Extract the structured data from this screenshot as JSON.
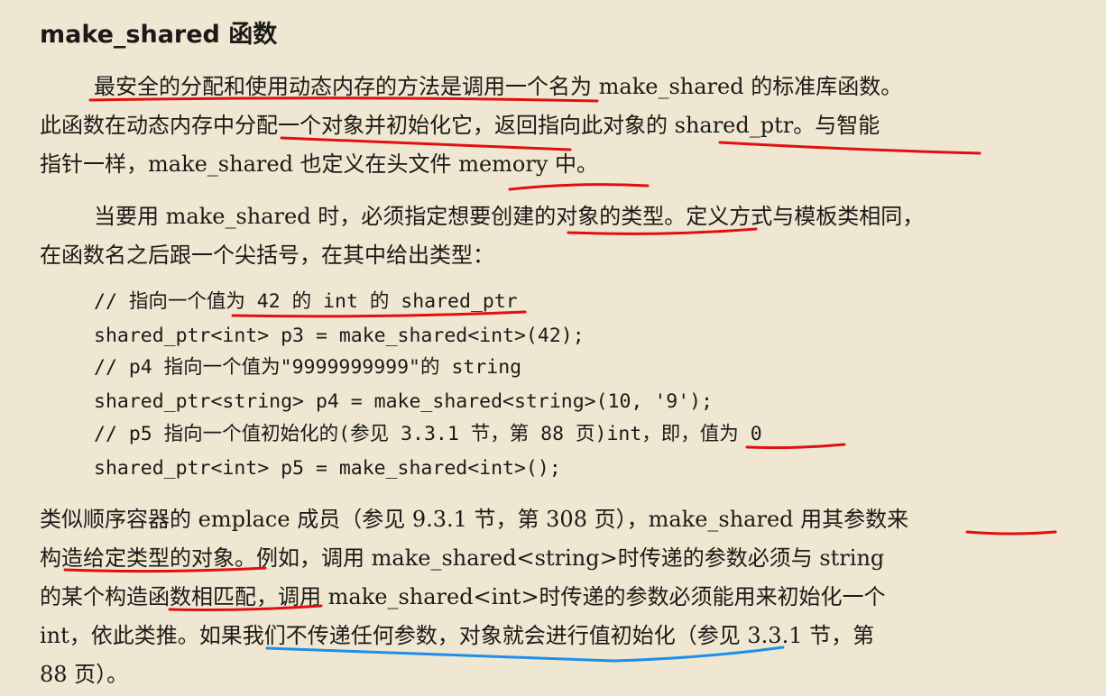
{
  "heading": "make_shared 函数",
  "p1": [
    "最安全的分配和使用动态内存的方法是调用一个名为 make_shared 的标准库函数。",
    "此函数在动态内存中分配一个对象并初始化它，返回指向此对象的 shared_ptr。与智能",
    "指针一样，make_shared 也定义在头文件 memory 中。"
  ],
  "p2": [
    "当要用 make_shared 时，必须指定想要创建的对象的类型。定义方式与模板类相同，",
    "在函数名之后跟一个尖括号，在其中给出类型："
  ],
  "code": [
    "// 指向一个值为 42 的 int 的 shared_ptr",
    "shared_ptr<int> p3 = make_shared<int>(42);",
    "// p4 指向一个值为\"9999999999\"的 string",
    "shared_ptr<string> p4 = make_shared<string>(10, '9');",
    "// p5 指向一个值初始化的(参见 3.3.1 节，第 88 页)int，即，值为 0",
    "shared_ptr<int> p5 = make_shared<int>();"
  ],
  "p3": [
    "类似顺序容器的 emplace 成员（参见 9.3.1 节，第 308 页），make_shared 用其参数来",
    "构造给定类型的对象。例如，调用 make_shared<string>时传递的参数必须与 string",
    "的某个构造函数相匹配，调用 make_shared<int>时传递的参数必须能用来初始化一个",
    "int，依此类推。如果我们不传递任何参数，对象就会进行值初始化（参见 3.3.1 节，第",
    "88 页）。"
  ],
  "colors": {
    "red_mark": "#e01010",
    "blue_mark": "#1e8fe8"
  }
}
